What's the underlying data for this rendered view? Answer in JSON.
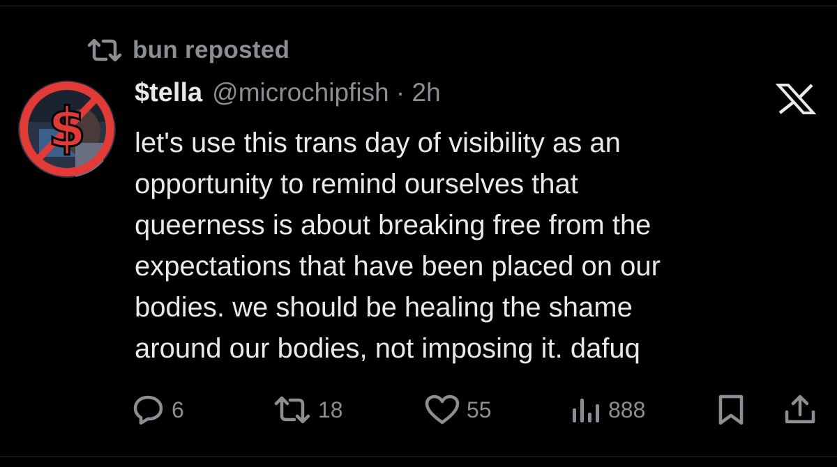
{
  "repost": {
    "label": "bun reposted",
    "icon": "repost-icon"
  },
  "tweet": {
    "display_name": "$tella",
    "handle_time": "@microchipfish · 2h",
    "avatar": {
      "icon": "dollar-sign-avatar",
      "ring_color": "#e23a36"
    },
    "text": "let's use this trans day of visibility as an\nopportunity to remind ourselves that\nqueerness is about breaking free from the\nexpectations that have been placed on our\nbodies. we should be healing the shame\naround our bodies, not imposing it. dafuq"
  },
  "brand": {
    "logo": "x-logo"
  },
  "actions": {
    "reply": {
      "icon": "reply-icon",
      "count": "6"
    },
    "repost": {
      "icon": "repost-icon",
      "count": "18"
    },
    "like": {
      "icon": "heart-icon",
      "count": "55"
    },
    "views": {
      "icon": "views-icon",
      "count": "888"
    },
    "bookmark": {
      "icon": "bookmark-icon"
    },
    "share": {
      "icon": "share-icon"
    }
  },
  "colors": {
    "background": "#000000",
    "text": "#e7e9ea",
    "muted": "#8b8f94"
  }
}
